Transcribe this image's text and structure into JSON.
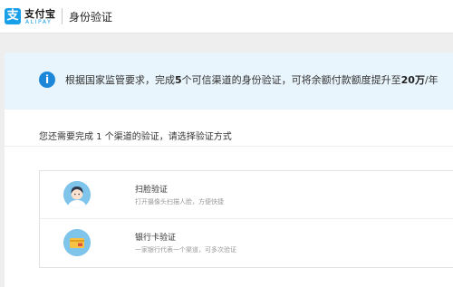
{
  "header": {
    "logo_mark": "支",
    "logo_cn": "支付宝",
    "logo_en": "ALIPAY",
    "page_title": "身份验证"
  },
  "notice": {
    "icon_char": "i",
    "text_part1": "根据国家监管要求，完成",
    "text_bold1": "5",
    "text_part2": "个可信渠道的身份验证，可将余额付款额度提升至",
    "text_bold2": "20万",
    "text_part3": "/年"
  },
  "subline": "您还需要完成 1 个渠道的验证，请选择验证方式",
  "methods": [
    {
      "title": "扫脸验证",
      "desc": "打开摄像头扫描人脸，方便快捷",
      "icon": "face-avatar-icon"
    },
    {
      "title": "银行卡验证",
      "desc": "一家银行代表一个渠道，可多次验证",
      "icon": "bank-card-icon"
    }
  ],
  "colors": {
    "brand_blue": "#1aa0e8",
    "info_blue": "#1c87d9",
    "notice_bg": "#e9f5fd",
    "card_yellow": "#f6c245",
    "card_red": "#e2513a"
  }
}
